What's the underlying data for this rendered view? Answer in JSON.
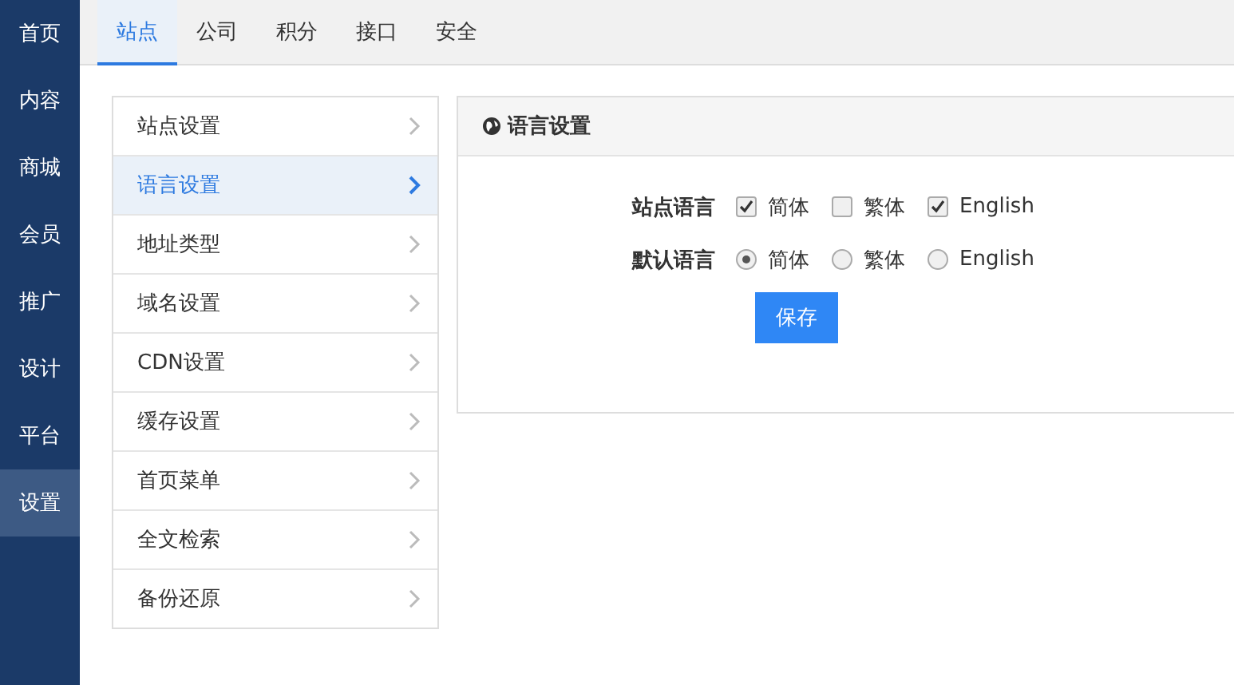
{
  "nav": [
    {
      "label": "首页",
      "selected": false
    },
    {
      "label": "内容",
      "selected": false
    },
    {
      "label": "商城",
      "selected": false
    },
    {
      "label": "会员",
      "selected": false
    },
    {
      "label": "推广",
      "selected": false
    },
    {
      "label": "设计",
      "selected": false
    },
    {
      "label": "平台",
      "selected": false
    },
    {
      "label": "设置",
      "selected": true
    }
  ],
  "tabs": [
    {
      "label": "站点",
      "selected": true
    },
    {
      "label": "公司",
      "selected": false
    },
    {
      "label": "积分",
      "selected": false
    },
    {
      "label": "接口",
      "selected": false
    },
    {
      "label": "安全",
      "selected": false
    }
  ],
  "menu": [
    {
      "label": "站点设置",
      "selected": false
    },
    {
      "label": "语言设置",
      "selected": true
    },
    {
      "label": "地址类型",
      "selected": false
    },
    {
      "label": "域名设置",
      "selected": false
    },
    {
      "label": "CDN设置",
      "selected": false
    },
    {
      "label": "缓存设置",
      "selected": false
    },
    {
      "label": "首页菜单",
      "selected": false
    },
    {
      "label": "全文检索",
      "selected": false
    },
    {
      "label": "备份还原",
      "selected": false
    }
  ],
  "panel": {
    "title": "语言设置",
    "rows": [
      {
        "label": "站点语言",
        "kind": "checkbox",
        "options": [
          {
            "label": "简体",
            "checked": true
          },
          {
            "label": "繁体",
            "checked": false
          },
          {
            "label": "English",
            "checked": true
          }
        ]
      },
      {
        "label": "默认语言",
        "kind": "radio",
        "options": [
          {
            "label": "简体",
            "checked": true
          },
          {
            "label": "繁体",
            "checked": false
          },
          {
            "label": "English",
            "checked": false
          }
        ]
      }
    ],
    "save_button": "保存"
  }
}
